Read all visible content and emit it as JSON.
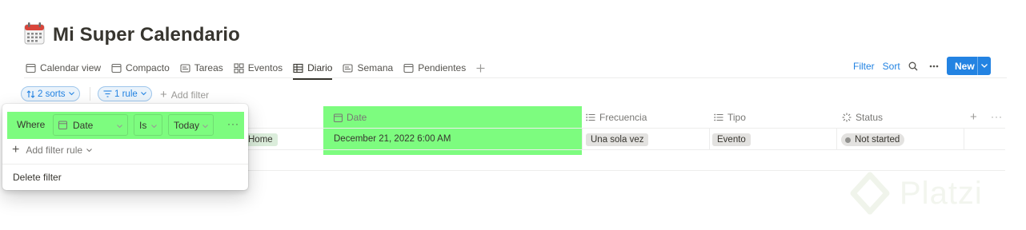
{
  "page": {
    "title": "Mi Super Calendario",
    "icon": "calendar-icon"
  },
  "tabs": [
    {
      "label": "Calendar view",
      "icon": "calendar-view-icon"
    },
    {
      "label": "Compacto",
      "icon": "calendar-view-icon"
    },
    {
      "label": "Tareas",
      "icon": "board-icon"
    },
    {
      "label": "Eventos",
      "icon": "gallery-icon"
    },
    {
      "label": "Diario",
      "icon": "table-icon",
      "active": true
    },
    {
      "label": "Semana",
      "icon": "board-icon"
    },
    {
      "label": "Pendientes",
      "icon": "calendar-view-icon"
    }
  ],
  "toolbar": {
    "filter_label": "Filter",
    "sort_label": "Sort",
    "new_label": "New",
    "accent_color": "#2383e2"
  },
  "filters": {
    "sorts_label": "2 sorts",
    "rule_label": "1 rule",
    "add_filter_label": "Add filter"
  },
  "popup": {
    "where_label": "Where",
    "property": "Date",
    "operator": "Is",
    "value": "Today",
    "add_rule_label": "Add filter rule",
    "delete_label": "Delete filter"
  },
  "table": {
    "columns": [
      {
        "label": "Date",
        "icon": "calendar-prop-icon"
      },
      {
        "label": "Frecuencia",
        "icon": "list-prop-icon"
      },
      {
        "label": "Tipo",
        "icon": "list-prop-icon"
      },
      {
        "label": "Status",
        "icon": "status-prop-icon"
      }
    ],
    "row": {
      "partial_tag": "Home",
      "date": "December 21, 2022 6:00 AM",
      "frecuencia": "Una sola vez",
      "tipo": "Evento",
      "status": "Not started"
    }
  },
  "highlight_color": "#7dfc7f",
  "watermark": "Platzi"
}
